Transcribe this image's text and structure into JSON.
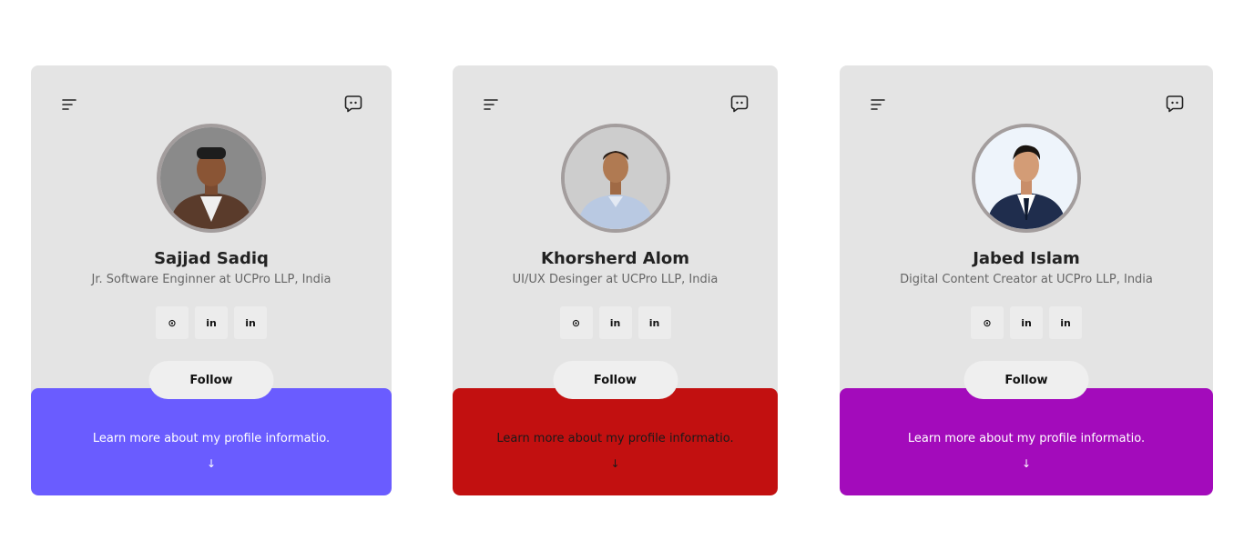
{
  "cards": [
    {
      "name": "Sajjad Sadiq",
      "role": "Jr. Software Enginner at UCPro LLP, India",
      "socials": [
        {
          "icon": "github-icon",
          "label": "⊙"
        },
        {
          "icon": "linkedin-icon",
          "label": "in"
        },
        {
          "icon": "linkedin-icon",
          "label": "in"
        }
      ],
      "follow_label": "Follow",
      "footer_text": "Learn more about my profile informatio.",
      "footer_arrow": "↓",
      "accent": "#6a5cff",
      "footer_text_color": "#ffffff"
    },
    {
      "name": "Khorsherd Alom",
      "role": "UI/UX Desinger at UCPro LLP, India",
      "socials": [
        {
          "icon": "github-icon",
          "label": "⊙"
        },
        {
          "icon": "linkedin-icon",
          "label": "in"
        },
        {
          "icon": "linkedin-icon",
          "label": "in"
        }
      ],
      "follow_label": "Follow",
      "footer_text": "Learn more about my profile informatio.",
      "footer_arrow": "↓",
      "accent": "#c21010",
      "footer_text_color": "#1a1a1a"
    },
    {
      "name": "Jabed Islam",
      "role": "Digital Content Creator at UCPro LLP, India",
      "socials": [
        {
          "icon": "github-icon",
          "label": "⊙"
        },
        {
          "icon": "linkedin-icon",
          "label": "in"
        },
        {
          "icon": "linkedin-icon",
          "label": "in"
        }
      ],
      "follow_label": "Follow",
      "footer_text": "Learn more about my profile informatio.",
      "footer_arrow": "↓",
      "accent": "#a30bbb",
      "footer_text_color": "#ffffff"
    }
  ]
}
